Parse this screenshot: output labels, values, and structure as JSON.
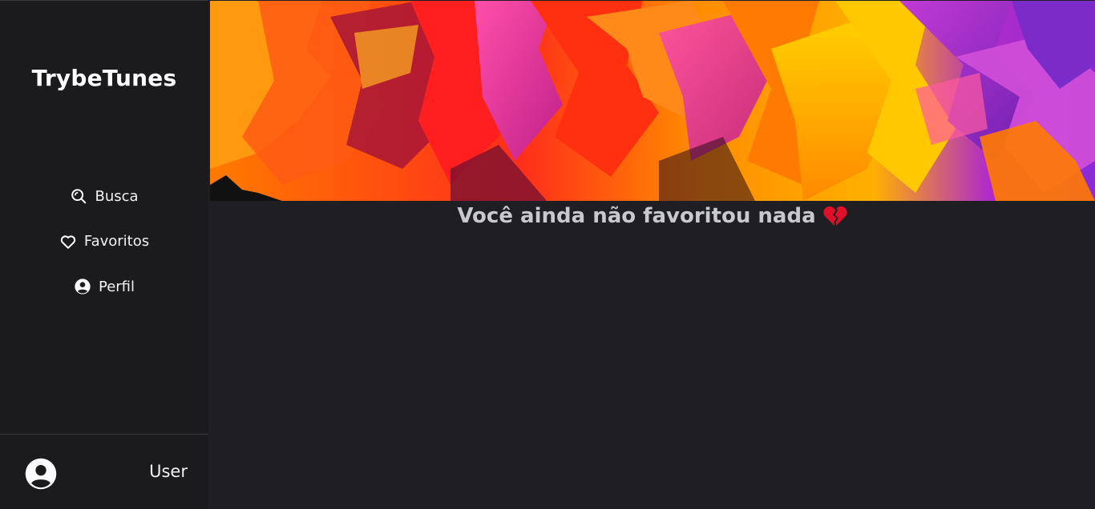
{
  "sidebar": {
    "brand": "TrybeTunes",
    "nav": [
      {
        "label": "Busca",
        "icon": "search-icon"
      },
      {
        "label": "Favoritos",
        "icon": "heart-outline-icon"
      },
      {
        "label": "Perfil",
        "icon": "user-circle-icon"
      }
    ],
    "footer": {
      "username": "User",
      "avatar_icon": "user-circle-icon"
    }
  },
  "main": {
    "banner_image": "abstract colorful paint splash banner",
    "empty_message": "Você ainda não favoritou nada",
    "empty_icon": "broken-heart-icon"
  },
  "colors": {
    "sidebar_bg": "#1b1b1e",
    "main_bg": "#1f1e23",
    "text_primary": "#ffffff",
    "text_muted": "#c8c8cf",
    "broken_heart": "#e0102a"
  }
}
